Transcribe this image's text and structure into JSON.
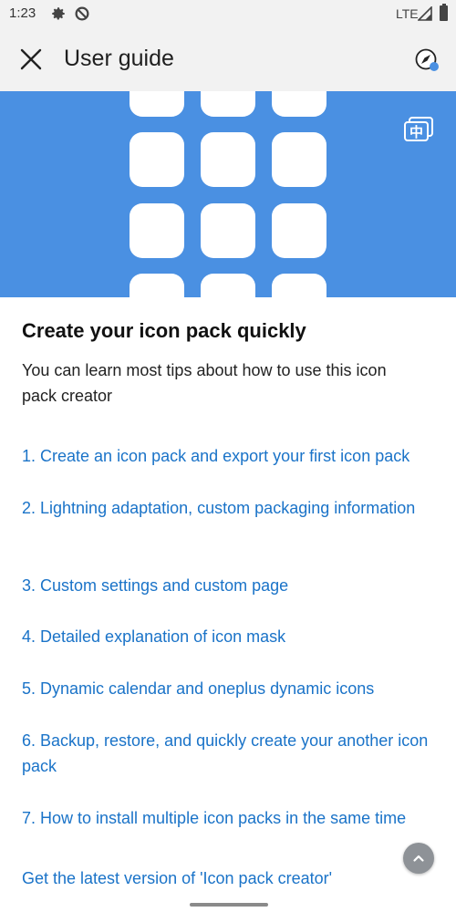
{
  "status_bar": {
    "time": "1:23",
    "network": "LTE",
    "icons": [
      "gear-icon",
      "sync-blocked-icon",
      "signal-icon",
      "battery-icon"
    ]
  },
  "app_bar": {
    "title": "User guide",
    "close_icon": "close-icon",
    "action_icon": "compass-icon"
  },
  "banner": {
    "color": "#4a90e2",
    "tile_color": "#ffffff",
    "translate_icon": "translate-icon",
    "translate_glyph": "中"
  },
  "content": {
    "heading": "Create your icon pack quickly",
    "subtitle": "You can learn most tips about how to use this icon pack creator",
    "links": [
      "1. Create an icon pack and export your first icon pack",
      "2. Lightning adaptation, custom packaging information",
      "3. Custom settings and custom page",
      "4. Detailed explanation of icon mask",
      "5. Dynamic calendar and oneplus dynamic icons",
      "6. Backup, restore, and quickly create your another icon pack",
      "7. How to install multiple icon packs in the same time",
      "Get the latest version of 'Icon pack creator'"
    ],
    "link_color": "#1a73c8"
  },
  "fab": {
    "icon": "chevron-up-icon"
  }
}
